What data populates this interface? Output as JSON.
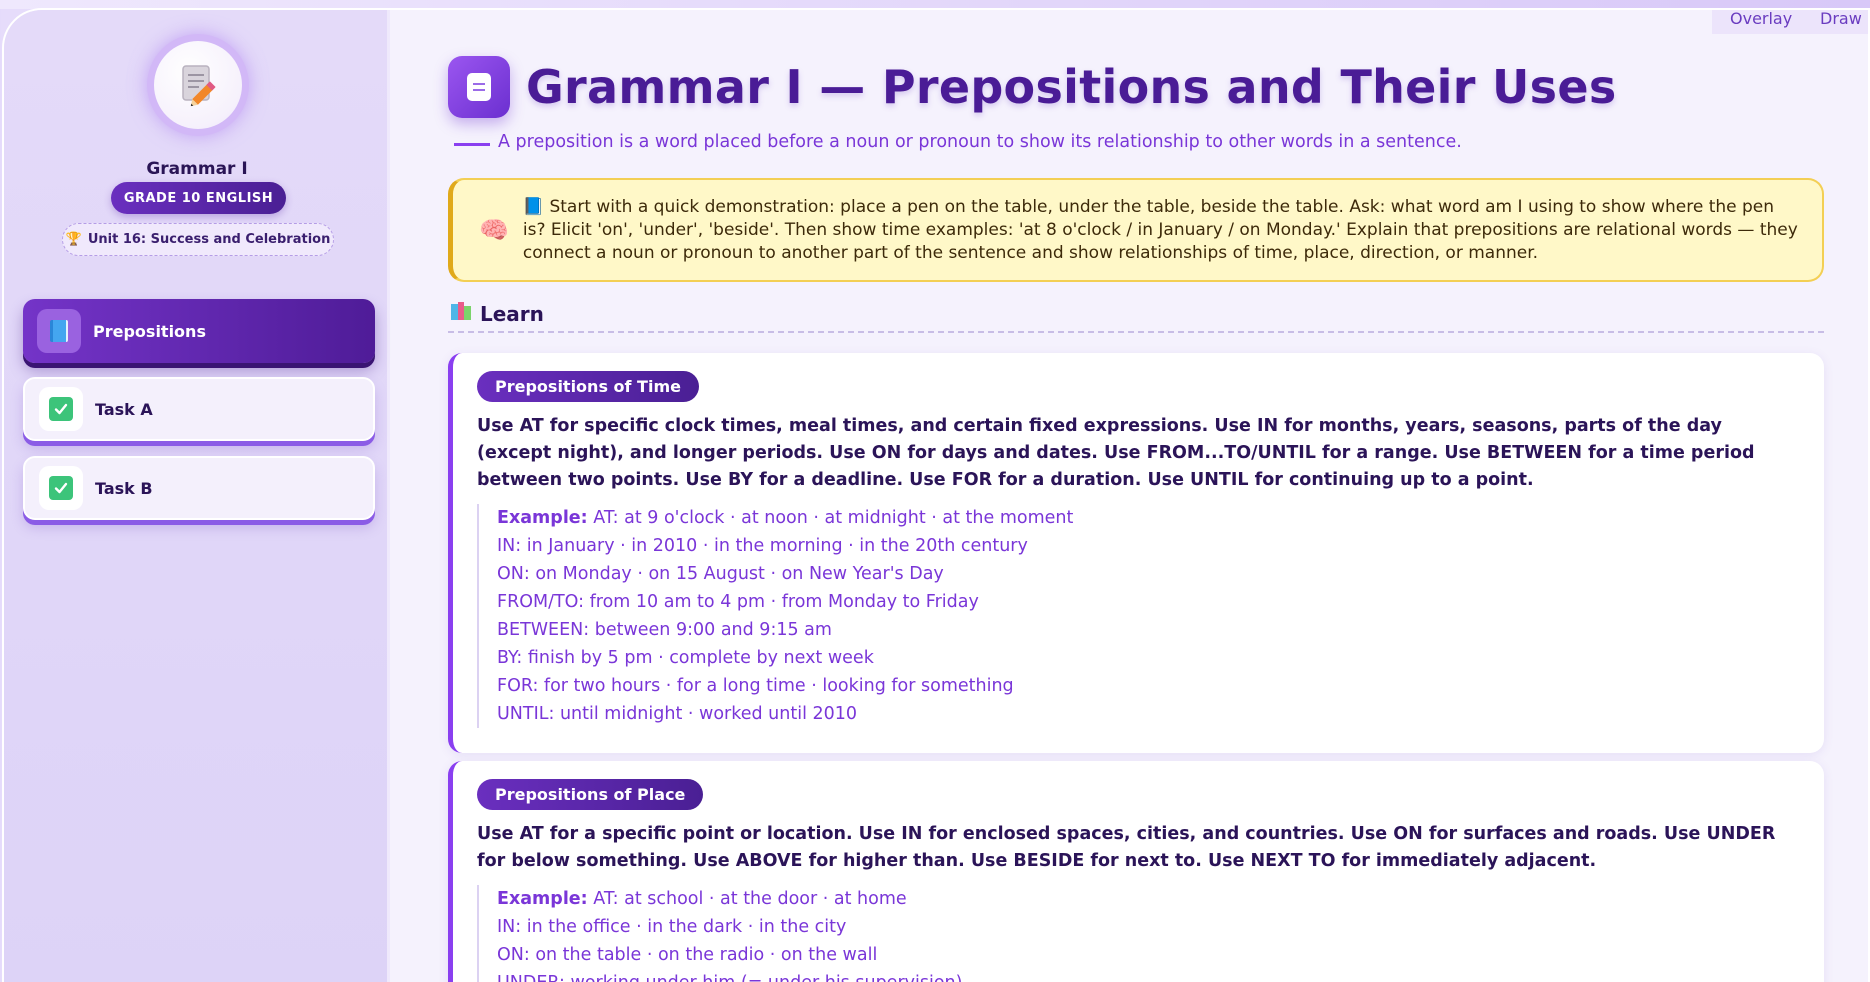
{
  "top_actions": {
    "overlay": "Overlay",
    "draw": "Draw"
  },
  "sidebar": {
    "app_title": "Grammar I",
    "grade": "GRADE 10 ENGLISH",
    "unit_icon": "🏆",
    "unit": "Unit 16: Success and Celebration",
    "items": [
      {
        "label": "Prepositions",
        "icon": "book-icon",
        "active": true
      },
      {
        "label": "Task A",
        "icon": "check-icon",
        "active": false
      },
      {
        "label": "Task B",
        "icon": "check-icon",
        "active": false
      }
    ]
  },
  "header": {
    "title": "Grammar I — Prepositions and Their Uses",
    "subtitle": "A preposition is a word placed before a noun or pronoun to show its relationship to other words in a sentence."
  },
  "teacher_note": {
    "icon": "🧠",
    "text": "📘 Start with a quick demonstration: place a pen on the table, under the table, beside the table. Ask: what word am I using to show where the pen is? Elicit 'on', 'under', 'beside'. Then show time examples: 'at 8 o'clock / in January / on Monday.' Explain that prepositions are relational words — they connect a noun or pronoun to another part of the sentence and show relationships of time, place, direction, or manner."
  },
  "learn": {
    "heading": "Learn",
    "cards": [
      {
        "title": "Prepositions of Time",
        "body": "Use AT for specific clock times, meal times, and certain fixed expressions. Use IN for months, years, seasons, parts of the day (except night), and longer periods. Use ON for days and dates. Use FROM...TO/UNTIL for a range. Use BETWEEN for a time period between two points. Use BY for a deadline. Use FOR for a duration. Use UNTIL for continuing up to a point.",
        "example_label": "Example:",
        "examples": [
          "AT: at 9 o'clock · at noon · at midnight · at the moment",
          "IN: in January · in 2010 · in the morning · in the 20th century",
          "ON: on Monday · on 15 August · on New Year's Day",
          "FROM/TO: from 10 am to 4 pm · from Monday to Friday",
          "BETWEEN: between 9:00 and 9:15 am",
          "BY: finish by 5 pm · complete by next week",
          "FOR: for two hours · for a long time · looking for something",
          "UNTIL: until midnight · worked until 2010"
        ]
      },
      {
        "title": "Prepositions of Place",
        "body": "Use AT for a specific point or location. Use IN for enclosed spaces, cities, and countries. Use ON for surfaces and roads. Use UNDER for below something. Use ABOVE for higher than. Use BESIDE for next to. Use NEXT TO for immediately adjacent.",
        "example_label": "Example:",
        "examples": [
          "AT: at school · at the door · at home",
          "IN: in the office · in the dark · in the city",
          "ON: on the table · on the radio · on the wall",
          "UNDER: working under him (= under his supervision)"
        ]
      }
    ]
  }
}
